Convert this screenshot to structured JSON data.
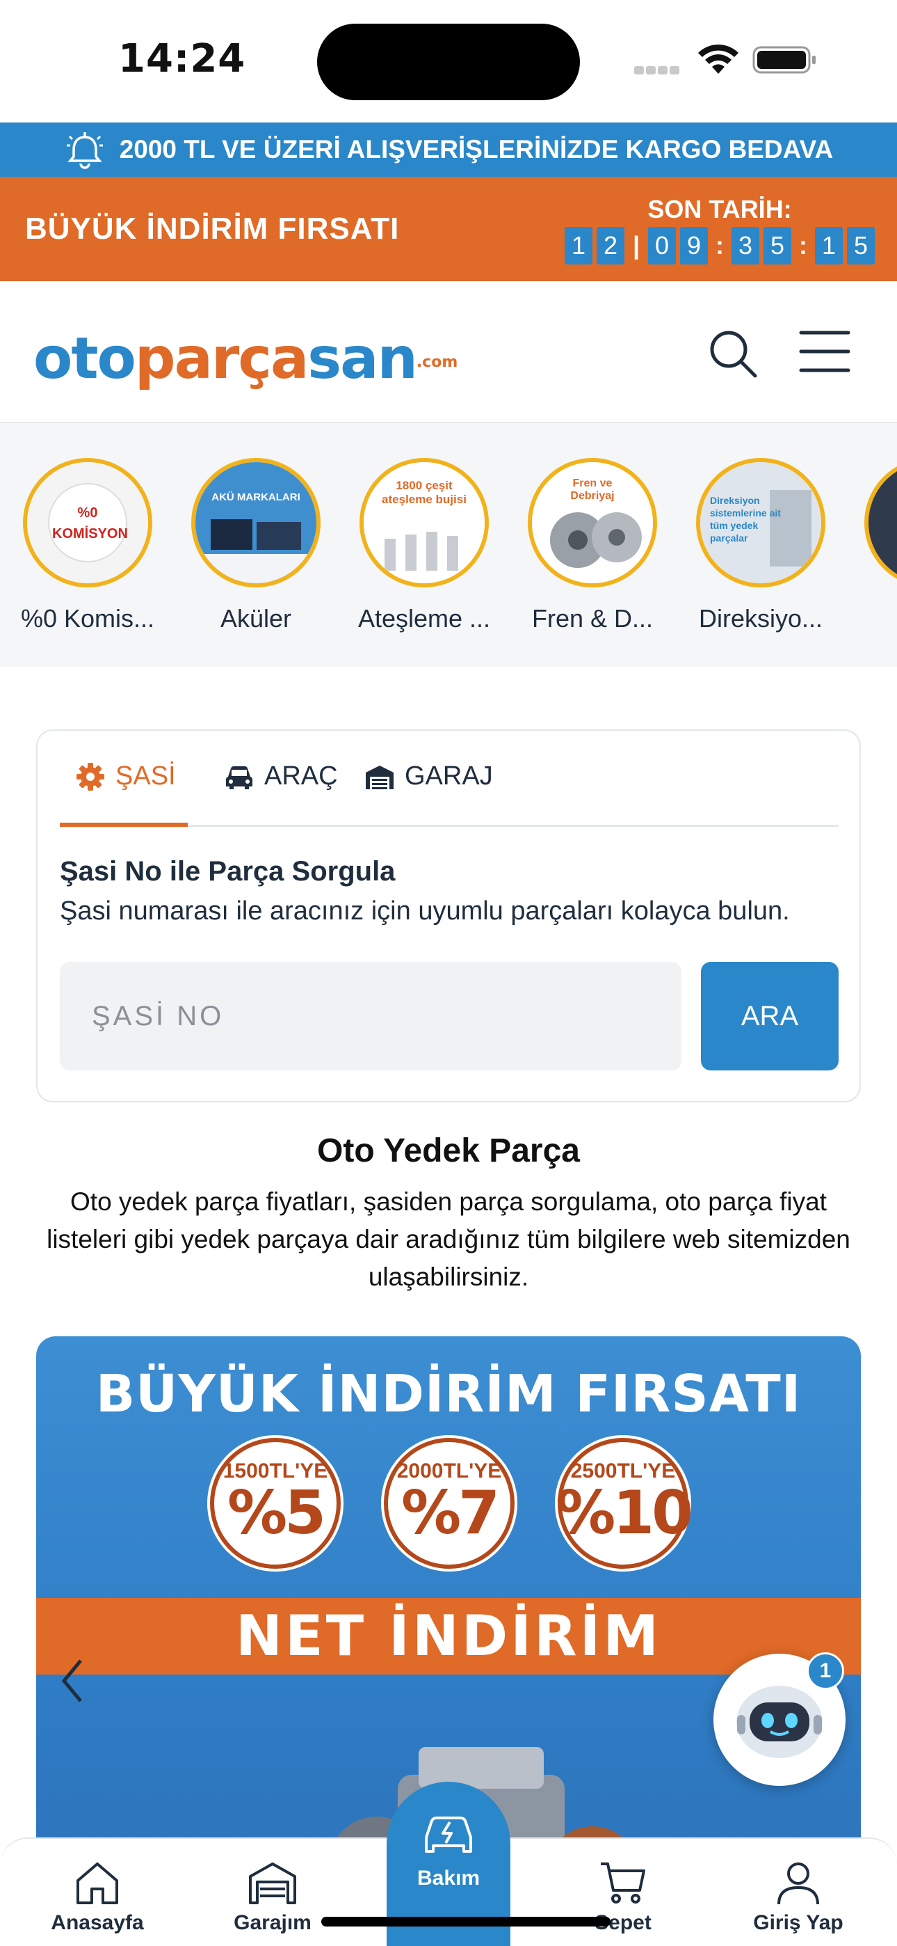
{
  "status_bar": {
    "time": "14:24"
  },
  "shipping_bar": {
    "text": "2000 TL VE ÜZERİ ALIŞVERİŞLERİNİZDE KARGO BEDAVA"
  },
  "promo_bar": {
    "title": "BÜYÜK İNDİRİM FIRSATI",
    "deadline_label": "SON TARİH:",
    "countdown": [
      "1",
      "2",
      "|",
      "0",
      "9",
      ":",
      "3",
      "5",
      ":",
      "1",
      "5"
    ]
  },
  "header": {
    "logo_part1": "oto",
    "logo_part2": "parça",
    "logo_part3": "san",
    "logo_suffix": ".com",
    "search_icon": "search-icon",
    "menu_icon": "hamburger-menu-icon"
  },
  "categories": [
    {
      "label": "%0 Komis...",
      "thumb": "%0 KOMİSYON"
    },
    {
      "label": "Aküler",
      "thumb": "AKÜ MARKALARI"
    },
    {
      "label": "Ateşleme ...",
      "thumb": "1800 çeşit ateşleme bujisi"
    },
    {
      "label": "Fren & D...",
      "thumb": "Fren ve Debriyaj"
    },
    {
      "label": "Direksiyo...",
      "thumb": "Direksiyon sistemlerine ait tüm yedek parçalar"
    }
  ],
  "search_card": {
    "tabs": [
      {
        "label": "ŞASİ",
        "icon": "gear-icon"
      },
      {
        "label": "ARAÇ",
        "icon": "car-icon"
      },
      {
        "label": "GARAJ",
        "icon": "garage-icon"
      }
    ],
    "title": "Şasi No ile Parça Sorgula",
    "description": "Şasi numarası ile aracınız için uyumlu parçaları kolayca bulun.",
    "input_placeholder": "ŞASİ NO",
    "button_label": "ARA"
  },
  "intro": {
    "title": "Oto Yedek Parça",
    "text": "Oto yedek parça fiyatları, şasiden parça sorgulama, oto parça fiyat listeleri gibi yedek parçaya dair aradığınız tüm bilgilere web sitemizden ulaşabilirsiniz."
  },
  "banner": {
    "title": "BÜYÜK İNDİRİM FIRSATI",
    "badges": [
      {
        "amount": "1500TL'YE",
        "percent": "%5"
      },
      {
        "amount": "2000TL'YE",
        "percent": "%7"
      },
      {
        "amount": "2500TL'YE",
        "percent": "%10"
      }
    ],
    "strip": "NET İNDİRİM"
  },
  "chatbot": {
    "badge_count": "1"
  },
  "bottom_nav": [
    {
      "label": "Anasayfa",
      "icon": "home-icon"
    },
    {
      "label": "Garajım",
      "icon": "garage-icon"
    },
    {
      "label": "Bakım",
      "icon": "car-maintenance-icon"
    },
    {
      "label": "Sepet",
      "icon": "cart-icon"
    },
    {
      "label": "Giriş Yap",
      "icon": "user-icon"
    }
  ],
  "colors": {
    "brand_blue": "#2a87c9",
    "brand_orange": "#e06a27",
    "badge_ring": "#f2b21b"
  }
}
